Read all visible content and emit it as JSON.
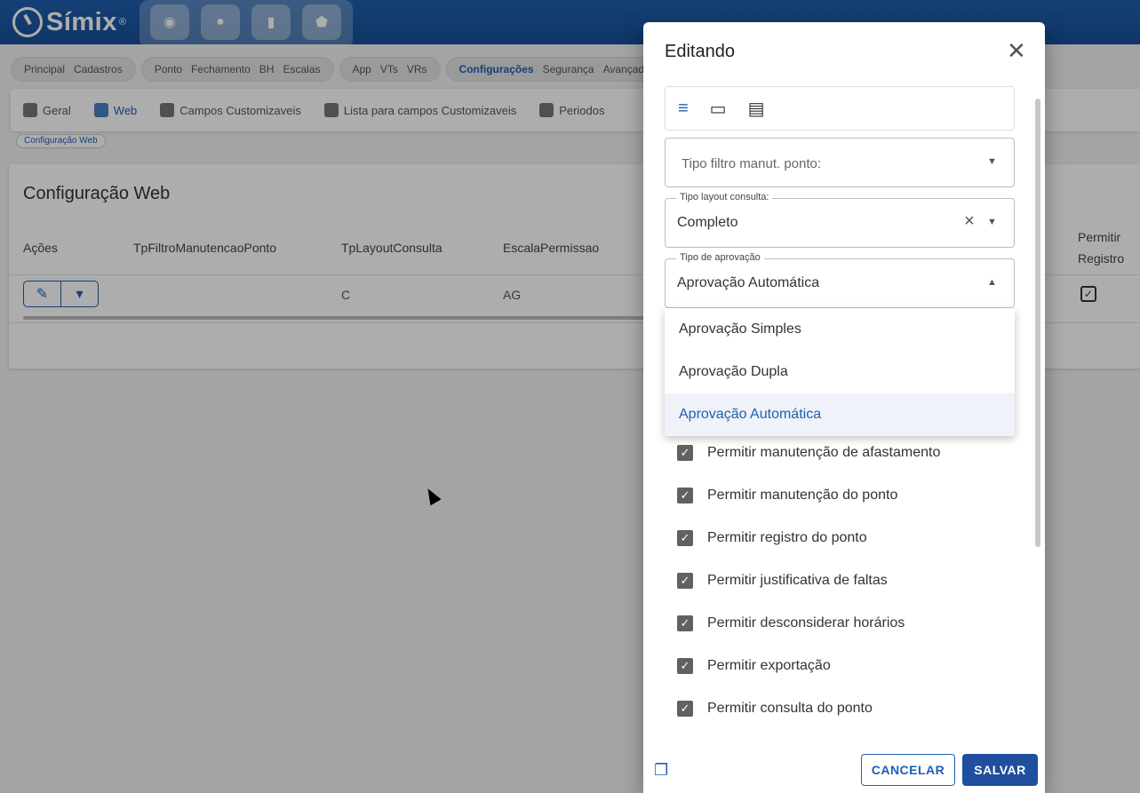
{
  "app": {
    "name": "Símix",
    "reg": "®"
  },
  "topnav": {
    "icons": [
      "globe-icon",
      "person-icon",
      "chart-icon",
      "shield-icon"
    ]
  },
  "menu_groups": [
    [
      "Principal",
      "Cadastros"
    ],
    [
      "Ponto",
      "Fechamento",
      "BH",
      "Escalas"
    ],
    [
      "App",
      "VTs",
      "VRs"
    ],
    [
      "Configurações",
      "Segurança",
      "Avançado"
    ]
  ],
  "subnav": [
    {
      "label": "Geral",
      "icon": "gear-icon"
    },
    {
      "label": "Web",
      "icon": "web-gear-icon"
    },
    {
      "label": "Campos Customizaveis",
      "icon": "custom-fields-icon"
    },
    {
      "label": "Lista para campos Customizaveis",
      "icon": "list-icon"
    },
    {
      "label": "Periodos",
      "icon": "folder-icon"
    }
  ],
  "breadcrumb": "Configuração Web",
  "card": {
    "title": "Configuração Web",
    "columns": [
      "Ações",
      "TpFiltroManutencaoPonto",
      "TpLayoutConsulta",
      "EscalaPermissao"
    ],
    "last_column_1": "Permitir",
    "last_column_2": "Registro",
    "row": {
      "layout": "C",
      "escala": "AG"
    }
  },
  "dialog": {
    "title": "Editando",
    "filter_placeholder": "Tipo filtro manut. ponto:",
    "layout_label": "Tipo layout consulta:",
    "layout_value": "Completo",
    "approval_label": "Tipo de aprovação",
    "approval_value": "Aprovação Automática",
    "options": [
      "Aprovação Simples",
      "Aprovação Dupla",
      "Aprovação Automática"
    ],
    "checkboxes": [
      "Permitir manutenção de afastamento",
      "Permitir manutenção do ponto",
      "Permitir registro do ponto",
      "Permitir justificativa de faltas",
      "Permitir desconsiderar horários",
      "Permitir exportação",
      "Permitir consulta do ponto"
    ],
    "cancel": "CANCELAR",
    "save": "SALVAR"
  },
  "colors": {
    "primary": "#1f5fb0",
    "header": "#184f98"
  }
}
